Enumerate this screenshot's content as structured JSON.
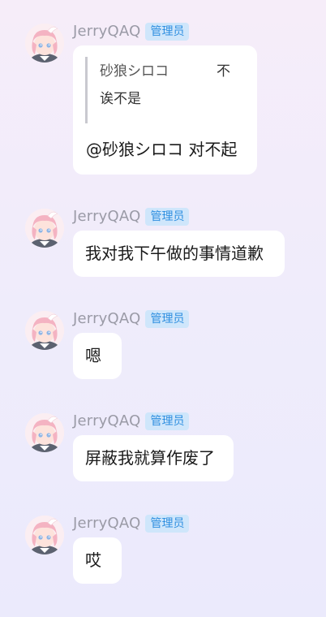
{
  "messages": [
    {
      "nickname": "JerryQAQ",
      "role_badge": "管理员",
      "quote": {
        "author": "砂狼シロコ",
        "text_line1": "不",
        "text_line2": "诶不是"
      },
      "text": "@砂狼シロコ 对不起"
    },
    {
      "nickname": "JerryQAQ",
      "role_badge": "管理员",
      "text": "我对我下午做的事情道歉"
    },
    {
      "nickname": "JerryQAQ",
      "role_badge": "管理员",
      "text": "嗯"
    },
    {
      "nickname": "JerryQAQ",
      "role_badge": "管理员",
      "text": "屏蔽我就算作废了"
    },
    {
      "nickname": "JerryQAQ",
      "role_badge": "管理员",
      "text": "哎"
    }
  ],
  "colors": {
    "background_top": "#f6edf9",
    "background_bottom": "#ebeafc",
    "bubble": "#ffffff",
    "badge_bg": "#cfe6fb",
    "badge_text": "#2f8fe0",
    "nickname": "#9a9aa6"
  },
  "icons": {
    "avatar": "anime-girl-avatar"
  }
}
